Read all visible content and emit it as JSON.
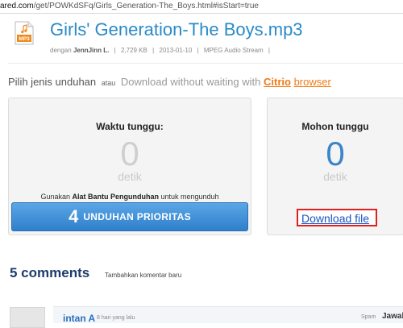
{
  "browser": {
    "url_host": "ared.com",
    "url_path": "/get/POWKdSFq/Girls_Generation-The_Boys.html#isStart=true"
  },
  "file": {
    "icon_label": "MP3",
    "title": "Girls' Generation-The Boys.mp3",
    "by_prefix": "dengan",
    "uploader": "JennJinn L.",
    "size": "2,729 KB",
    "date": "2013-01-10",
    "type": "MPEG Audio Stream"
  },
  "choose": {
    "label": "Pilih jenis unduhan",
    "atau": "atau",
    "nowait": "Download without waiting with",
    "citrio": "Citrio",
    "browser": "browser"
  },
  "left_box": {
    "wait_label": "Waktu tunggu:",
    "count": "0",
    "unit": "detik",
    "hint_pre": "Gunakan",
    "hint_bold": "Alat Bantu Pengunduhan",
    "hint_post": "untuk mengunduh",
    "priority_num": "4",
    "priority_label": "UNDUHAN PRIORITAS"
  },
  "right_box": {
    "wait_label": "Mohon tunggu",
    "count": "0",
    "unit": "detik",
    "download_link": "Download file"
  },
  "comments": {
    "title": "5 comments",
    "add_label": "Tambahkan komentar baru",
    "first": {
      "name": "intan A",
      "time": "8 hari yang lalu",
      "spam": "Spam",
      "reply": "Jawab"
    }
  },
  "colors": {
    "title_blue": "#2a8ac9",
    "accent_orange": "#f07a14",
    "button_blue": "#2f7fcb",
    "highlight_red": "#e01f1f"
  }
}
